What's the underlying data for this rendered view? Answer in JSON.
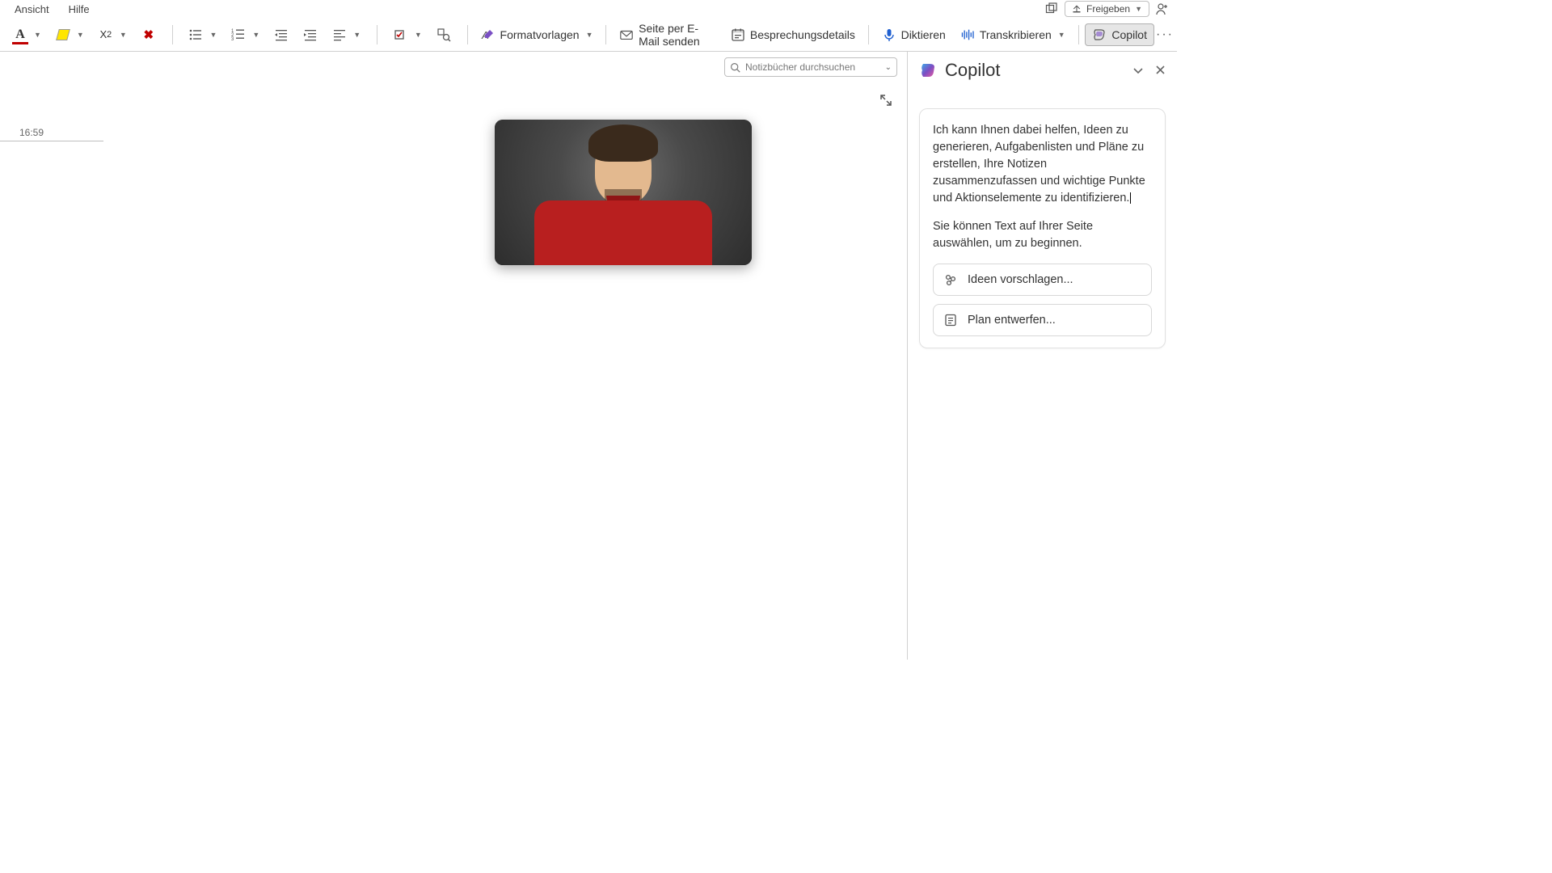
{
  "menubar": {
    "view": "Ansicht",
    "help": "Hilfe",
    "share": "Freigeben"
  },
  "toolbar": {
    "styles": "Formatvorlagen",
    "email_page": "Seite per E-Mail senden",
    "meeting_details": "Besprechungsdetails",
    "dictate": "Diktieren",
    "transcribe": "Transkribieren",
    "copilot": "Copilot"
  },
  "page": {
    "timestamp": "16:59",
    "search_placeholder": "Notizbücher durchsuchen"
  },
  "copilot": {
    "title": "Copilot",
    "intro": "Ich kann Ihnen dabei helfen, Ideen zu generieren, Aufgabenlisten und Pläne zu erstellen, Ihre Notizen zusammenzufassen und wichtige Punkte und Aktionselemente zu identifizieren.",
    "hint": "Sie können Text auf Ihrer Seite auswählen, um zu beginnen.",
    "suggestions": {
      "ideas": "Ideen vorschlagen...",
      "plan": "Plan entwerfen..."
    }
  }
}
